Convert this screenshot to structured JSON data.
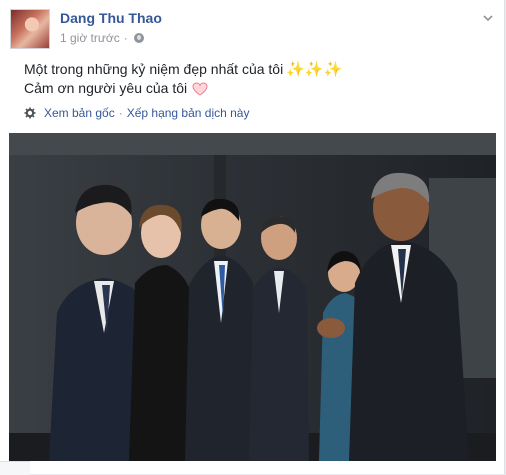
{
  "post": {
    "author": "Dang Thu Thao",
    "timestamp": "1 giờ trước",
    "separator": "·",
    "line1": "Một trong những kỷ niệm đẹp nhất của tôi",
    "line2": "Cảm ơn người yêu của tôi",
    "sparkles": "✨✨✨",
    "translate_original": "Xem bản gốc",
    "translate_dot": "·",
    "translate_rate": "Xếp hạng bản dịch này"
  },
  "icons": {
    "audience": "globe-icon",
    "options": "chevron-down-icon",
    "translate": "gear-icon",
    "emoji_heart": "heart-icon",
    "emoji_sparkles": "sparkles-icon"
  },
  "colors": {
    "author": "#365899",
    "meta": "#90949c",
    "body_text": "#1d2129",
    "heart": "#f7a8b0",
    "sparkle": "#f6b40e"
  }
}
